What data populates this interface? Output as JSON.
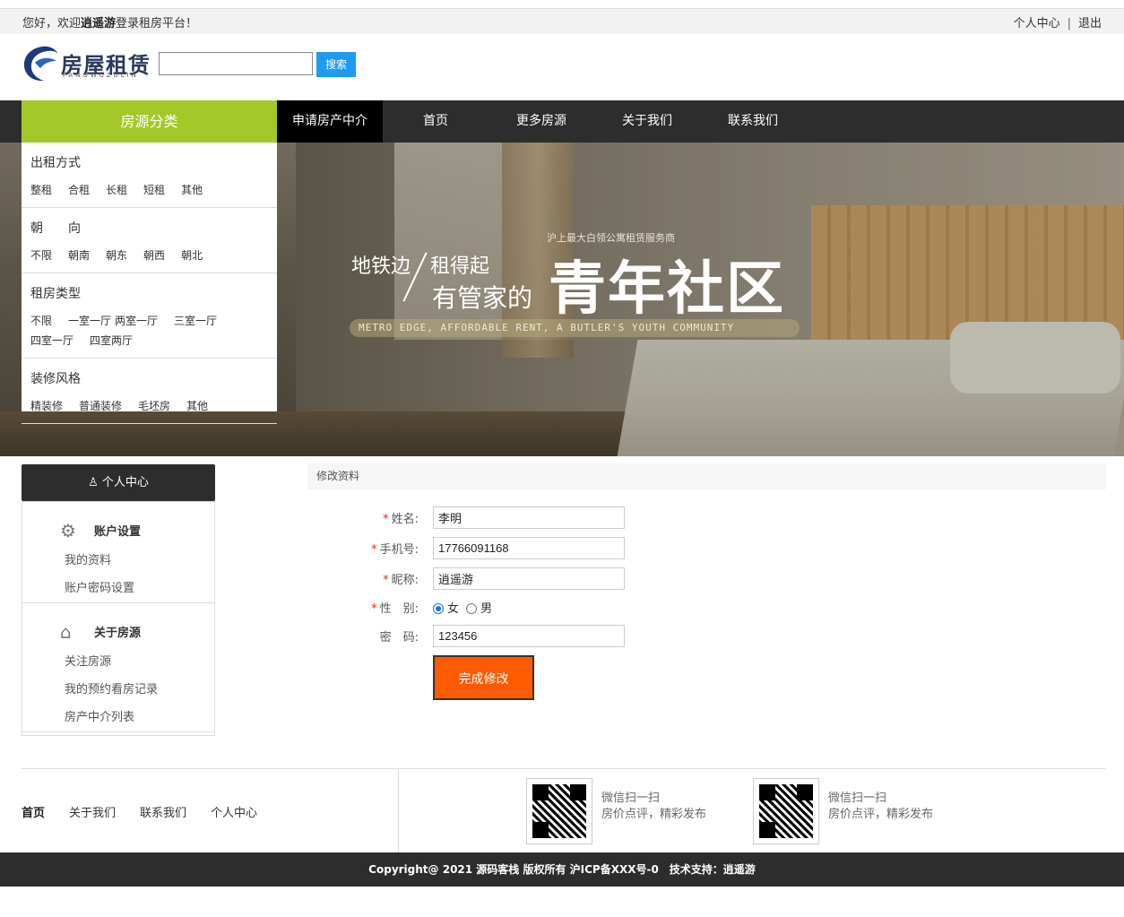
{
  "topbar": {
    "welcome_prefix": "您好，欢迎",
    "welcome_user": "逍遥游",
    "welcome_suffix": "登录租房平台！",
    "user_center": "个人中心",
    "separator": "|",
    "logout": "退出"
  },
  "header": {
    "logo_title": "房屋租赁",
    "logo_sub": "FANGWUZULIN",
    "search_placeholder": "",
    "search_button": "搜索"
  },
  "nav": {
    "category_label": "房源分类",
    "items": [
      {
        "label": "申请房产中介",
        "active": true
      },
      {
        "label": "首页"
      },
      {
        "label": "更多房源"
      },
      {
        "label": "关于我们"
      },
      {
        "label": "联系我们"
      }
    ]
  },
  "banner": {
    "tag": "沪上最大白领公寓租赁服务商",
    "line1a": "地铁边",
    "line1b": "租得起",
    "line2": "有管家的",
    "headline": "青年社区",
    "english": "METRO EDGE, AFFORDABLE RENT, A BUTLER'S YOUTH COMMUNITY"
  },
  "categories": [
    {
      "title": "出租方式",
      "options": [
        "整租",
        "合租",
        "长租",
        "短租",
        "其他"
      ]
    },
    {
      "title": "朝　　向",
      "options": [
        "不限",
        "朝南",
        "朝东",
        "朝西",
        "朝北"
      ]
    },
    {
      "title": "租房类型",
      "options": [
        "不限",
        "一室一厅",
        "两室一厅",
        "三室一厅",
        "四室一厅",
        "四室两厅"
      ]
    },
    {
      "title": "装修风格",
      "options": [
        "精装修",
        "普通装修",
        "毛坯房",
        "其他"
      ]
    }
  ],
  "user_center": {
    "title": "个人中心",
    "sections": [
      {
        "title": "账户设置",
        "icon": "gear-icon",
        "items": [
          "我的资料",
          "账户密码设置"
        ]
      },
      {
        "title": "关于房源",
        "icon": "house-icon",
        "items": [
          "关注房源",
          "我的预约看房记录",
          "房产中介列表"
        ]
      }
    ]
  },
  "form": {
    "heading": "修改资料",
    "required_mark": "*",
    "name_label": "姓名:",
    "name_value": "李明",
    "phone_label": "手机号:",
    "phone_value": "17766091168",
    "nick_label": "昵称:",
    "nick_value": "逍遥游",
    "gender_label": "性　别:",
    "gender_female": "女",
    "gender_male": "男",
    "gender_selected": "女",
    "password_label": "密　码:",
    "password_value": "123456",
    "submit": "完成修改"
  },
  "footer": {
    "links": [
      "首页",
      "关于我们",
      "联系我们",
      "个人中心"
    ],
    "qr": [
      {
        "line1": "微信扫一扫",
        "line2": "房价点评，精彩发布"
      },
      {
        "line1": "微信扫一扫",
        "line2": "房价点评，精彩发布"
      }
    ],
    "copyright": "Copyright@ 2021 源码客栈 版权所有 沪ICP备XXX号-0　技术支持：逍遥游"
  },
  "colors": {
    "nav_bg": "#2d2d2d",
    "category_green": "#a4c827",
    "search_blue": "#1e9bf0",
    "submit_orange": "#ff5a00",
    "required_red": "#e1251b"
  }
}
